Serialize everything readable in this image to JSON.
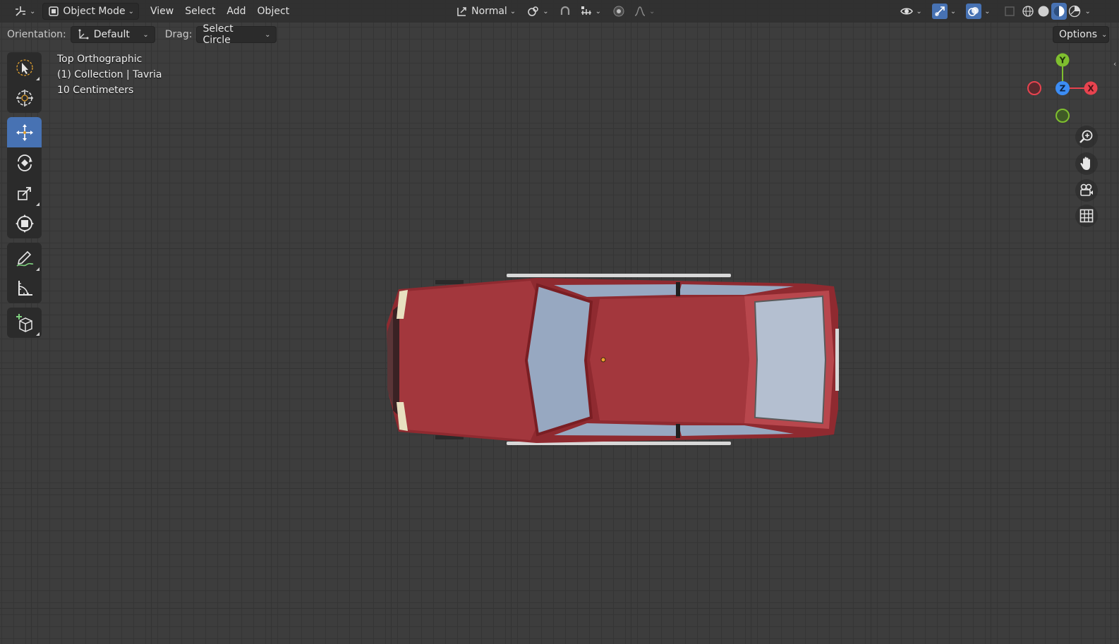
{
  "header": {
    "editor_type_icon": "axes-icon",
    "mode": "Object Mode",
    "menus": [
      "View",
      "Select",
      "Add",
      "Object"
    ],
    "transform_orientation": "Normal",
    "icons": [
      "pivot-icon",
      "snap-icon",
      "snap-increment-icon",
      "proportional-edit-icon",
      "falloff-icon",
      "visibility-icon",
      "gizmo-icon",
      "overlay-icon",
      "xray-icon",
      "wireframe-icon",
      "solid-icon",
      "material-icon",
      "rendered-icon"
    ]
  },
  "tool_settings": {
    "orientation_label": "Orientation:",
    "orientation_value": "Default",
    "drag_label": "Drag:",
    "drag_value": "Select Circle",
    "options_label": "Options"
  },
  "toolbar": {
    "tools": [
      "select-box",
      "cursor",
      "move",
      "rotate",
      "scale",
      "transform",
      "annotate",
      "measure",
      "add-cube"
    ],
    "active": "move"
  },
  "viewport_info": {
    "line1": "Top Orthographic",
    "line2": "(1) Collection | Tavria",
    "line3": "10 Centimeters"
  },
  "gizmo": {
    "x_label": "X",
    "y_label": "Y",
    "z_label": "Z",
    "x_color": "#e8434f",
    "y_color": "#7fbf2f",
    "z_color": "#3c8df5"
  },
  "accent": "#4772b3",
  "car_color": "#a3373d"
}
